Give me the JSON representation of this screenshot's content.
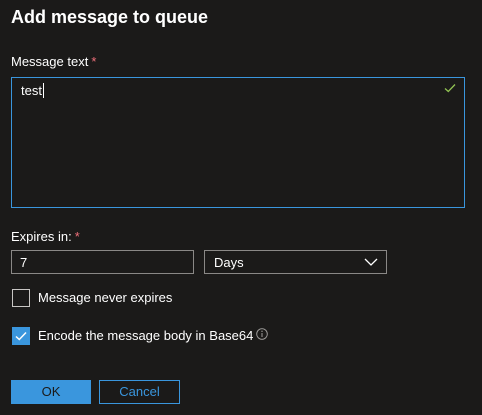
{
  "dialog": {
    "title": "Add message to queue",
    "required_marker": "*"
  },
  "message": {
    "label": "Message text",
    "value": "test",
    "valid_icon": "checkmark-icon"
  },
  "expires": {
    "label": "Expires in:",
    "value": "7",
    "unit_selected": "Days",
    "unit_icon": "chevron-down-icon"
  },
  "options": {
    "never_expires": {
      "label": "Message never expires",
      "checked": false
    },
    "base64": {
      "label": "Encode the message body in Base64",
      "checked": true,
      "info_icon": "info-icon"
    }
  },
  "buttons": {
    "ok_label": "OK",
    "cancel_label": "Cancel"
  },
  "colors": {
    "background": "#1b1a19",
    "accent": "#3a96dd",
    "required": "#f1707b",
    "valid": "#92c353",
    "border": "#8a8886"
  }
}
